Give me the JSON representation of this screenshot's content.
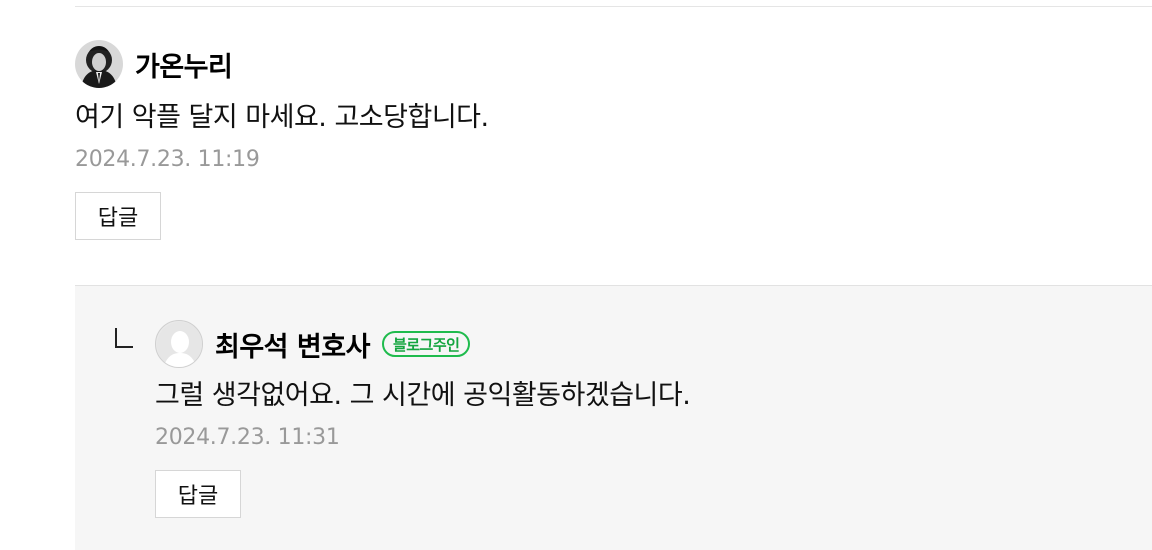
{
  "comment": {
    "avatar_icon": "profile-photo-icon",
    "nickname": "가온누리",
    "text": "여기 악플 달지 마세요. 고소당합니다.",
    "date": "2024.7.23. 11:19",
    "reply_label": "답글"
  },
  "reply": {
    "marker_icon": "reply-indent-icon",
    "avatar_icon": "default-avatar-icon",
    "nickname": "최우석 변호사",
    "badge": "블로그주인",
    "text": "그럴 생각없어요. 그 시간에 공익활동하겠습니다.",
    "date": "2024.7.23. 11:31",
    "reply_label": "답글"
  },
  "colors": {
    "badge_green": "#1fbb4d",
    "date_gray": "#999999",
    "reply_bg": "#f6f6f6"
  }
}
